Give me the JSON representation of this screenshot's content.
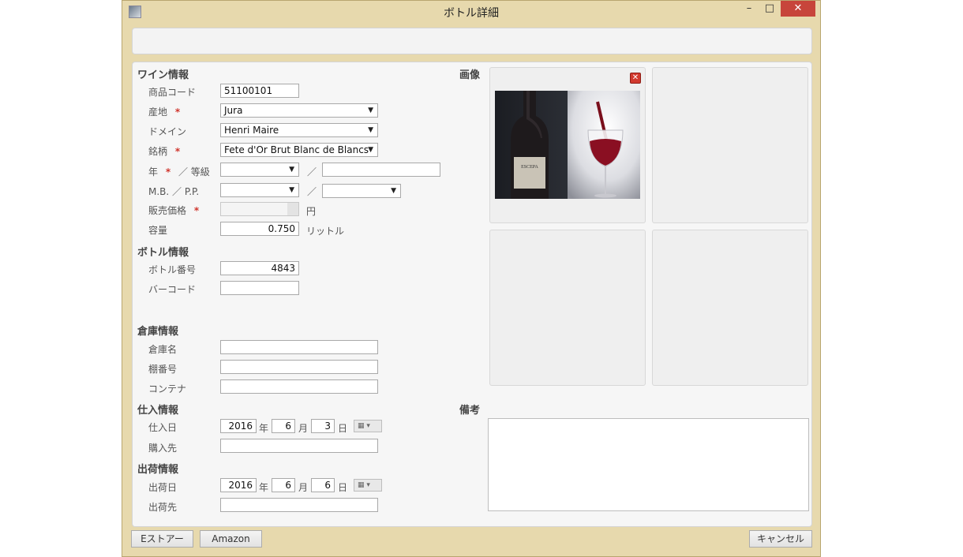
{
  "window": {
    "title": "ボトル詳細",
    "minimize": "–",
    "maximize": "□",
    "close": "✕"
  },
  "sections": {
    "wine": "ワイン情報",
    "bottle": "ボトル情報",
    "warehouse": "倉庫情報",
    "purchase": "仕入情報",
    "shipping": "出荷情報",
    "image": "画像",
    "remarks": "備考"
  },
  "wine": {
    "product_code_label": "商品コード",
    "product_code": "51100101",
    "origin_label": "産地",
    "origin": "Jura",
    "domain_label": "ドメイン",
    "domain": "Henri Maire",
    "brand_label": "銘柄",
    "brand": "Fete d'Or Brut Blanc de Blancs",
    "year_label": "年",
    "grade_label": "／ 等級",
    "slash": "／",
    "mbpp_label": "M.B. ／ P.P.",
    "price_label": "販売価格",
    "price_unit": "円",
    "volume_label": "容量",
    "volume": "0.750",
    "volume_unit": "リットル",
    "required_mark": "*"
  },
  "bottle": {
    "number_label": "ボトル番号",
    "number": "4843",
    "barcode_label": "バーコード",
    "barcode": ""
  },
  "warehouse": {
    "name_label": "倉庫名",
    "shelf_label": "棚番号",
    "container_label": "コンテナ"
  },
  "purchase": {
    "date_label": "仕入日",
    "year": "2016",
    "month": "6",
    "day": "3",
    "year_unit": "年",
    "month_unit": "月",
    "day_unit": "日",
    "supplier_label": "購入先"
  },
  "shipping": {
    "date_label": "出荷日",
    "year": "2016",
    "month": "6",
    "day": "6",
    "year_unit": "年",
    "month_unit": "月",
    "day_unit": "日",
    "destination_label": "出荷先"
  },
  "image_panel": {
    "delete_label": "✕",
    "bottle_brand": "ESCEPA"
  },
  "footer": {
    "estore_button": "Eストアー",
    "amazon_button": "Amazon",
    "cancel_button": "キャンセル"
  }
}
